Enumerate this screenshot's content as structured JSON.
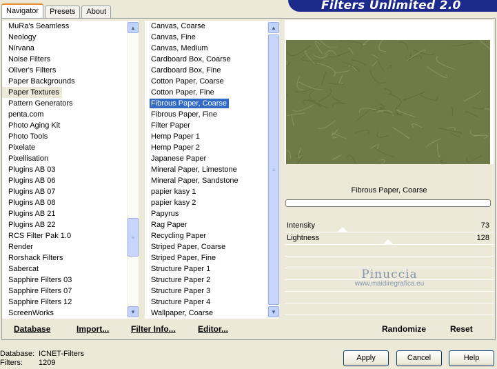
{
  "tabs": [
    {
      "label": "Navigator",
      "active": true
    },
    {
      "label": "Presets",
      "active": false
    },
    {
      "label": "About",
      "active": false
    }
  ],
  "app_title": "Filters Unlimited 2.0",
  "categories": {
    "items": [
      "MuRa's Seamless",
      "Neology",
      "Nirvana",
      "Noise Filters",
      "Oliver's Filters",
      "Paper Backgrounds",
      "Paper Textures",
      "Pattern Generators",
      "penta.com",
      "Photo Aging Kit",
      "Photo Tools",
      "Pixelate",
      "Pixellisation",
      "Plugins AB 03",
      "Plugins AB 06",
      "Plugins AB 07",
      "Plugins AB 08",
      "Plugins AB 21",
      "Plugins AB 22",
      "RCS Filter Pak 1.0",
      "Render",
      "Rorshack Filters",
      "Sabercat",
      "Sapphire Filters 03",
      "Sapphire Filters 07",
      "Sapphire Filters 12",
      "ScreenWorks"
    ],
    "highlighted": "Paper Textures"
  },
  "filters": {
    "items": [
      "Canvas, Coarse",
      "Canvas, Fine",
      "Canvas, Medium",
      "Cardboard Box, Coarse",
      "Cardboard Box, Fine",
      "Cotton Paper, Coarse",
      "Cotton Paper, Fine",
      "Fibrous Paper, Coarse",
      "Fibrous Paper, Fine",
      "Filter Paper",
      "Hemp Paper 1",
      "Hemp Paper 2",
      "Japanese Paper",
      "Mineral Paper, Limestone",
      "Mineral Paper, Sandstone",
      "papier kasy 1",
      "papier kasy 2",
      "Papyrus",
      "Rag Paper",
      "Recycling Paper",
      "Striped Paper, Coarse",
      "Striped Paper, Fine",
      "Structure Paper 1",
      "Structure Paper 2",
      "Structure Paper 3",
      "Structure Paper 4",
      "Wallpaper, Coarse"
    ],
    "selected": "Fibrous Paper, Coarse"
  },
  "bottom_links": {
    "database": "Database",
    "import": "Import...",
    "filter_info": "Filter Info...",
    "editor": "Editor...",
    "randomize": "Randomize",
    "reset": "Reset"
  },
  "preview": {
    "filter_name": "Fibrous Paper, Coarse",
    "texture_color": "#6f7a47",
    "progress": 0
  },
  "params": [
    {
      "name": "Intensity",
      "value": "73",
      "max": 255
    },
    {
      "name": "Lightness",
      "value": "128",
      "max": 255
    }
  ],
  "watermark": {
    "name": "Pinuccia",
    "url": "www.maidiregrafica.eu"
  },
  "status": {
    "database_label": "Database:",
    "database_value": "ICNET-Filters",
    "filters_label": "Filters:",
    "filters_value": "1209"
  },
  "buttons": {
    "apply": "Apply",
    "cancel": "Cancel",
    "help": "Help"
  },
  "colors": {
    "accent": "#316ac5",
    "banner": "#1c2a8c",
    "tab_highlight": "#e68b2c"
  }
}
